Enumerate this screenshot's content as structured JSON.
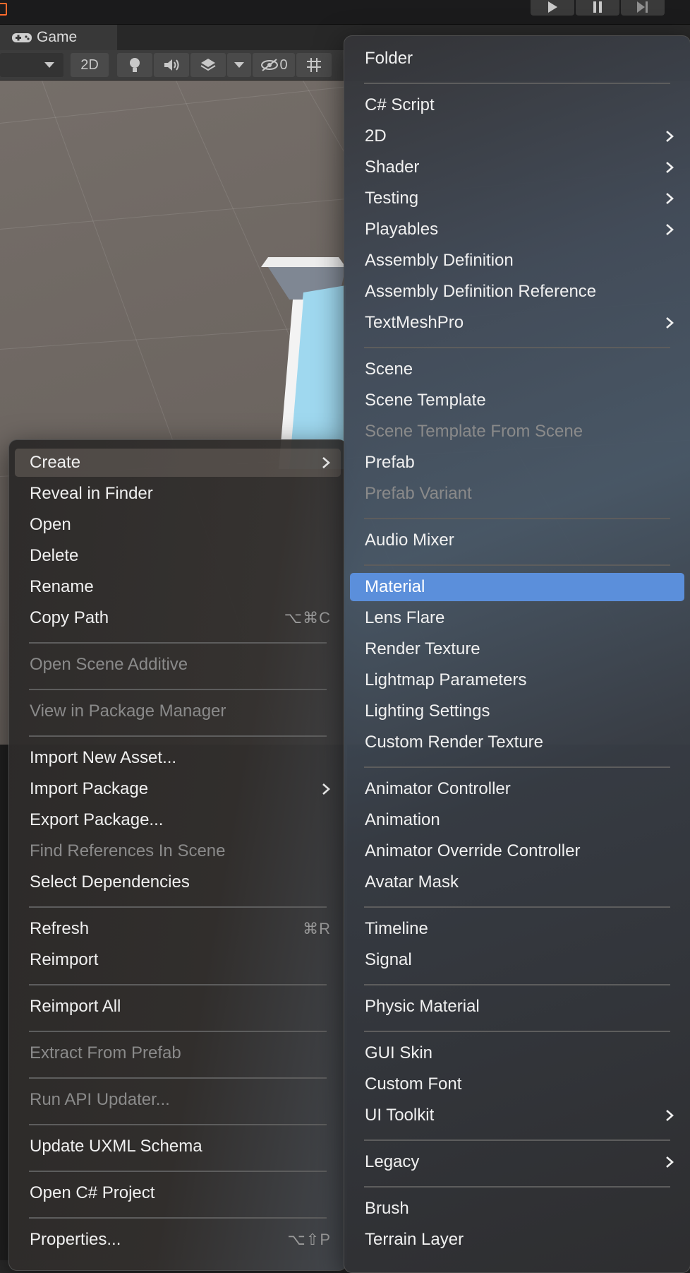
{
  "tab": {
    "game_label": "Game"
  },
  "toolbar": {
    "two_d": "2D",
    "hidden_count": "0"
  },
  "left_menu": {
    "items": [
      {
        "label": "Create",
        "submenu": true,
        "hover": true
      },
      {
        "label": "Reveal in Finder"
      },
      {
        "label": "Open"
      },
      {
        "label": "Delete"
      },
      {
        "label": "Rename"
      },
      {
        "label": "Copy Path",
        "shortcut": "⌥⌘C"
      },
      {
        "separator": true
      },
      {
        "label": "Open Scene Additive",
        "disabled": true
      },
      {
        "separator": true
      },
      {
        "label": "View in Package Manager",
        "disabled": true
      },
      {
        "separator": true
      },
      {
        "label": "Import New Asset..."
      },
      {
        "label": "Import Package",
        "submenu": true
      },
      {
        "label": "Export Package..."
      },
      {
        "label": "Find References In Scene",
        "disabled": true
      },
      {
        "label": "Select Dependencies"
      },
      {
        "separator": true
      },
      {
        "label": "Refresh",
        "shortcut": "⌘R"
      },
      {
        "label": "Reimport"
      },
      {
        "separator": true
      },
      {
        "label": "Reimport All"
      },
      {
        "separator": true
      },
      {
        "label": "Extract From Prefab",
        "disabled": true
      },
      {
        "separator": true
      },
      {
        "label": "Run API Updater...",
        "disabled": true
      },
      {
        "separator": true
      },
      {
        "label": "Update UXML Schema"
      },
      {
        "separator": true
      },
      {
        "label": "Open C# Project"
      },
      {
        "separator": true
      },
      {
        "label": "Properties...",
        "shortcut": "⌥⇧P"
      }
    ]
  },
  "right_menu": {
    "items": [
      {
        "label": "Folder"
      },
      {
        "separator": true
      },
      {
        "label": "C# Script"
      },
      {
        "label": "2D",
        "submenu": true
      },
      {
        "label": "Shader",
        "submenu": true
      },
      {
        "label": "Testing",
        "submenu": true
      },
      {
        "label": "Playables",
        "submenu": true
      },
      {
        "label": "Assembly Definition"
      },
      {
        "label": "Assembly Definition Reference"
      },
      {
        "label": "TextMeshPro",
        "submenu": true
      },
      {
        "separator": true
      },
      {
        "label": "Scene"
      },
      {
        "label": "Scene Template"
      },
      {
        "label": "Scene Template From Scene",
        "disabled": true
      },
      {
        "label": "Prefab"
      },
      {
        "label": "Prefab Variant",
        "disabled": true
      },
      {
        "separator": true
      },
      {
        "label": "Audio Mixer"
      },
      {
        "separator": true
      },
      {
        "label": "Material",
        "selected": true
      },
      {
        "label": "Lens Flare"
      },
      {
        "label": "Render Texture"
      },
      {
        "label": "Lightmap Parameters"
      },
      {
        "label": "Lighting Settings"
      },
      {
        "label": "Custom Render Texture"
      },
      {
        "separator": true
      },
      {
        "label": "Animator Controller"
      },
      {
        "label": "Animation"
      },
      {
        "label": "Animator Override Controller"
      },
      {
        "label": "Avatar Mask"
      },
      {
        "separator": true
      },
      {
        "label": "Timeline"
      },
      {
        "label": "Signal"
      },
      {
        "separator": true
      },
      {
        "label": "Physic Material"
      },
      {
        "separator": true
      },
      {
        "label": "GUI Skin"
      },
      {
        "label": "Custom Font"
      },
      {
        "label": "UI Toolkit",
        "submenu": true
      },
      {
        "separator": true
      },
      {
        "label": "Legacy",
        "submenu": true
      },
      {
        "separator": true
      },
      {
        "label": "Brush"
      },
      {
        "label": "Terrain Layer"
      }
    ]
  },
  "colors": {
    "selection": "#5b8fdb",
    "disabled_text": "#8a8a8a",
    "unity_accent": "#ff6a2b"
  }
}
